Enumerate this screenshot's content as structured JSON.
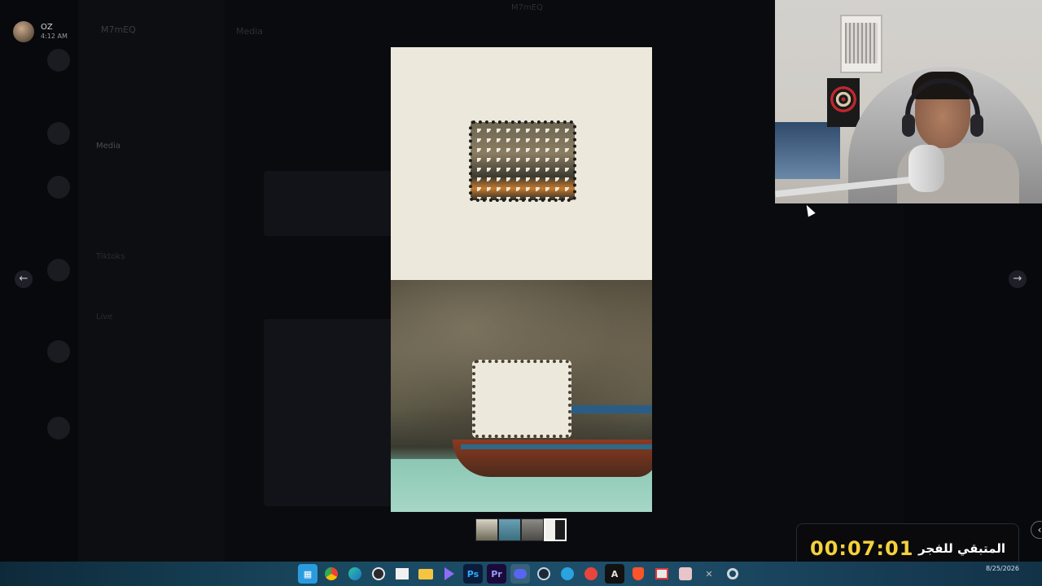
{
  "window_title": "M7mEQ",
  "user": {
    "name": "OZ",
    "time": "4:12 AM"
  },
  "server": {
    "name": "M7mEQ"
  },
  "channel_header": {
    "title": "Media"
  },
  "channels": [
    "Media",
    "Tiktoks",
    "Live"
  ],
  "viewer": {
    "thumbnail_count": 4,
    "selected_thumbnail": 4
  },
  "timer": {
    "label": "المتبقي للفجر",
    "countdown": "00:07:01"
  },
  "icons": {
    "prev": "arrow-left-icon",
    "next": "arrow-right-icon",
    "collapse": "chevron-left-icon"
  },
  "taskbar": {
    "apps": [
      "Start",
      "Chrome",
      "Edge",
      "OBS",
      "Store",
      "Files",
      "Stream",
      "Photoshop",
      "Premiere",
      "Discord",
      "Steam",
      "Telegram",
      "App",
      "Anthropic",
      "Brave",
      "Snip",
      "Anime",
      "Excel",
      "Settings"
    ],
    "active_app": "Discord",
    "date": "8/25/2026"
  }
}
